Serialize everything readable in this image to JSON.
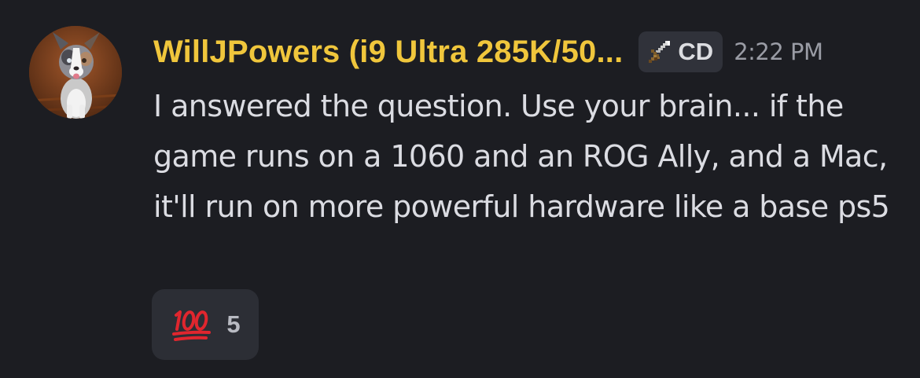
{
  "message": {
    "author": {
      "username": "WillJPowers (i9 Ultra 285K/50...",
      "name_color": "#f0c63c",
      "avatar": "dog-avatar"
    },
    "tag": {
      "icon": "sword-icon",
      "label": "CD"
    },
    "timestamp": "2:22 PM",
    "content": "I answered the question. Use your brain... if the game runs on a 1060 and an ROG Ally, and a Mac, it'll run on more powerful hardware like a base ps5",
    "reactions": [
      {
        "emoji": "hundred-points-icon",
        "count": "5"
      }
    ]
  },
  "colors": {
    "background": "#1c1d22",
    "text": "#dbdce2",
    "timestamp": "#9a9ca5",
    "reaction_bg": "#2c2e35"
  }
}
